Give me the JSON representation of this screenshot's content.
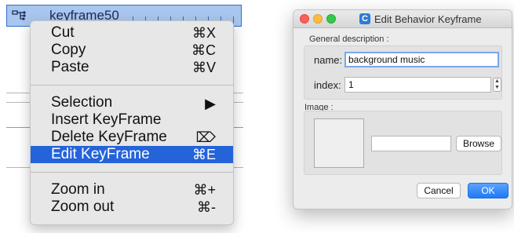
{
  "timeline": {
    "track_label": "keyframe50"
  },
  "context_menu": {
    "items": [
      {
        "label": "Cut",
        "shortcut": "⌘X"
      },
      {
        "label": "Copy",
        "shortcut": "⌘C"
      },
      {
        "label": "Paste",
        "shortcut": "⌘V"
      },
      {
        "label": "Selection",
        "shortcut": "▶"
      },
      {
        "label": "Insert KeyFrame",
        "shortcut": ""
      },
      {
        "label": "Delete KeyFrame",
        "shortcut": "⌦"
      },
      {
        "label": "Edit KeyFrame",
        "shortcut": "⌘E"
      },
      {
        "label": "Zoom in",
        "shortcut": "⌘+"
      },
      {
        "label": "Zoom out",
        "shortcut": "⌘-"
      }
    ],
    "active_item": "Edit KeyFrame"
  },
  "dialog": {
    "title": "Edit Behavior Keyframe",
    "app_icon_letter": "C",
    "general_section_label": "General description :",
    "name_label": "name:",
    "name_value": "background music",
    "index_label": "index:",
    "index_value": "1",
    "image_section_label": "Image :",
    "image_path_value": "",
    "browse_label": "Browse",
    "cancel_label": "Cancel",
    "ok_label": "OK"
  },
  "colors": {
    "accent": "#2563d9",
    "track_fill": "#a9c6ee",
    "ok_button": "#2179f4"
  }
}
